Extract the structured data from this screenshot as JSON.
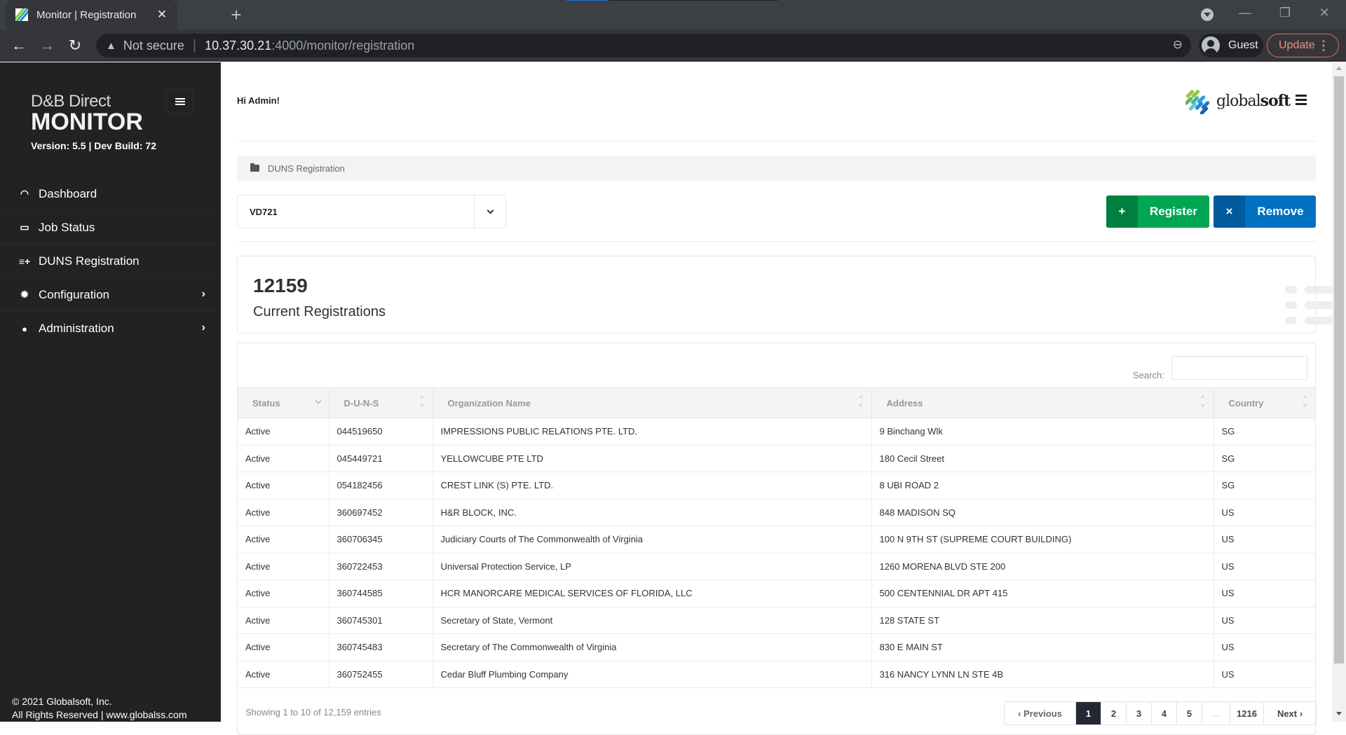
{
  "browser": {
    "tab_title": "Monitor | Registration",
    "tab_close": "✕",
    "new_tab": "+",
    "security_label": "Not secure",
    "url_host": "10.37.30.21",
    "url_path": ":4000/monitor/registration",
    "profile_name": "Guest",
    "update_label": "Update",
    "window_controls": {
      "minimize": "—",
      "restore": "❐",
      "close": "✕"
    }
  },
  "sidebar": {
    "brand_line1": "D&B Direct",
    "brand_line2": "MONITOR",
    "version": "Version: 5.5 | Dev Build: 72",
    "items": [
      {
        "label": "Dashboard",
        "icon": "speedometer-icon",
        "glyph": "◠",
        "has_children": false
      },
      {
        "label": "Job Status",
        "icon": "card-icon",
        "glyph": "▭",
        "has_children": false
      },
      {
        "label": "DUNS Registration",
        "icon": "list-add-icon",
        "glyph": "≡+",
        "has_children": false
      },
      {
        "label": "Configuration",
        "icon": "gear-icon",
        "glyph": "✹",
        "has_children": true
      },
      {
        "label": "Administration",
        "icon": "user-icon",
        "glyph": "👤",
        "has_children": true
      }
    ],
    "chevron": "›",
    "copyright_line1": "© 2021 Globalsoft, Inc.",
    "copyright_line2": "All Rights Reserved | www.globalss.com"
  },
  "header": {
    "greeting": "Hi Admin!",
    "logo_text_regular": "global",
    "logo_text_bold": "soft"
  },
  "breadcrumb": {
    "label": "DUNS Registration"
  },
  "selector": {
    "value": "VD721"
  },
  "actions": {
    "register": {
      "icon": "+",
      "label": "Register",
      "color": "#00a651"
    },
    "remove": {
      "icon": "×",
      "label": "Remove",
      "color": "#0070c0"
    }
  },
  "stats": {
    "count": "12159",
    "label": "Current Registrations"
  },
  "table": {
    "search_label": "Search:",
    "search_value": "",
    "columns": [
      "Status",
      "D-U-N-S",
      "Organization Name",
      "Address",
      "Country"
    ],
    "rows": [
      {
        "status": "Active",
        "duns": "044519650",
        "org": "IMPRESSIONS PUBLIC RELATIONS PTE. LTD.",
        "address": "9 Binchang Wlk",
        "country": "SG"
      },
      {
        "status": "Active",
        "duns": "045449721",
        "org": "YELLOWCUBE PTE LTD",
        "address": "180 Cecil Street",
        "country": "SG"
      },
      {
        "status": "Active",
        "duns": "054182456",
        "org": "CREST LINK (S) PTE. LTD.",
        "address": "8 UBI ROAD 2",
        "country": "SG"
      },
      {
        "status": "Active",
        "duns": "360697452",
        "org": "H&R BLOCK, INC.",
        "address": "848 MADISON SQ",
        "country": "US"
      },
      {
        "status": "Active",
        "duns": "360706345",
        "org": "Judiciary Courts of The Commonwealth of Virginia",
        "address": "100 N 9TH ST (SUPREME COURT BUILDING)",
        "country": "US"
      },
      {
        "status": "Active",
        "duns": "360722453",
        "org": "Universal Protection Service, LP",
        "address": "1260 MORENA BLVD STE 200",
        "country": "US"
      },
      {
        "status": "Active",
        "duns": "360744585",
        "org": "HCR MANORCARE MEDICAL SERVICES OF FLORIDA, LLC",
        "address": "500 CENTENNIAL DR APT 415",
        "country": "US"
      },
      {
        "status": "Active",
        "duns": "360745301",
        "org": "Secretary of State, Vermont",
        "address": "128 STATE ST",
        "country": "US"
      },
      {
        "status": "Active",
        "duns": "360745483",
        "org": "Secretary of The Commonwealth of Virginia",
        "address": "830 E MAIN ST",
        "country": "US"
      },
      {
        "status": "Active",
        "duns": "360752455",
        "org": "Cedar Bluff Plumbing Company",
        "address": "316 NANCY LYNN LN STE 4B",
        "country": "US"
      }
    ],
    "info": "Showing 1 to 10 of 12,159 entries"
  },
  "pagination": {
    "previous": "‹  Previous",
    "pages": [
      "1",
      "2",
      "3",
      "4",
      "5"
    ],
    "active_page": "1",
    "ellipsis": "…",
    "last": "1216",
    "next": "Next  ›"
  }
}
